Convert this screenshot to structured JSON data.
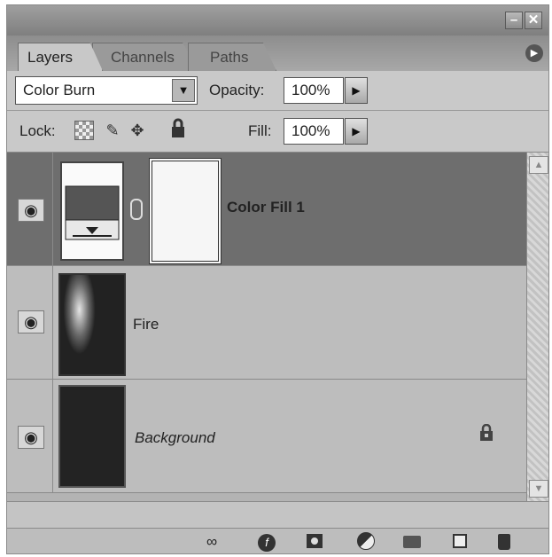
{
  "window": {
    "minimize_glyph": "–",
    "close_glyph": "✕"
  },
  "tabs": [
    {
      "label": "Layers",
      "active": true
    },
    {
      "label": "Channels",
      "active": false
    },
    {
      "label": "Paths",
      "active": false
    }
  ],
  "panel_menu_icon": "panel-menu-icon",
  "blend": {
    "mode": "Color Burn",
    "opacity_label": "Opacity:",
    "opacity_value": "100%"
  },
  "lock": {
    "label": "Lock:",
    "icons": [
      "lock-transparent-pixels-icon",
      "lock-image-pixels-icon",
      "lock-position-icon",
      "lock-all-icon"
    ],
    "fill_label": "Fill:",
    "fill_value": "100%"
  },
  "layers": [
    {
      "name": "Color Fill 1",
      "selected": true,
      "visible": true,
      "bold": true,
      "linked_mask": true
    },
    {
      "name": "Fire",
      "selected": false,
      "visible": true,
      "bold": false
    },
    {
      "name": "Background",
      "selected": false,
      "visible": true,
      "italic": true,
      "locked": true
    }
  ],
  "bottom_toolbar": [
    "link-layers-icon",
    "layer-style-icon",
    "layer-mask-icon",
    "adjustment-layer-icon",
    "new-group-icon",
    "new-layer-icon",
    "delete-layer-icon"
  ],
  "colors": {
    "panel_bg": "#d4d4d4",
    "selected_layer": "#6e6e6e"
  }
}
